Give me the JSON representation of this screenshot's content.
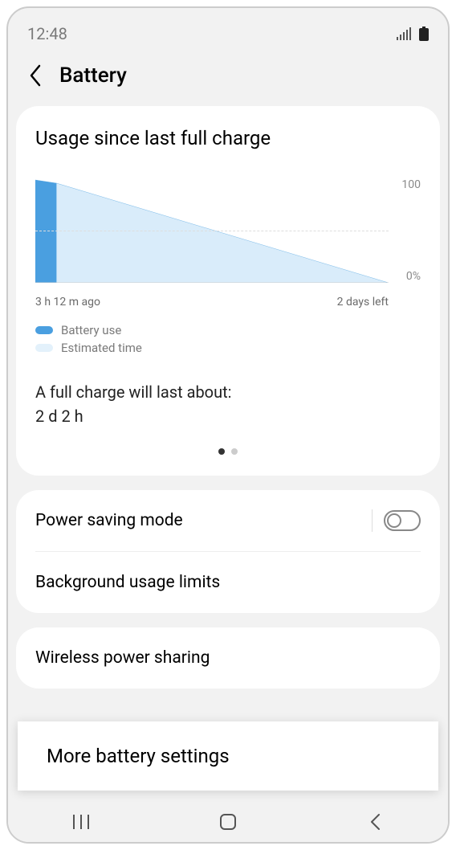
{
  "status": {
    "time": "12:48"
  },
  "page_title": "Battery",
  "usage_card": {
    "title": "Usage since last full charge",
    "chart_x_start": "3 h 12 m ago",
    "chart_x_end": "2 days left",
    "chart_y_top": "100",
    "chart_y_bottom": "0%",
    "legend_use": "Battery use",
    "legend_est": "Estimated time",
    "full_charge_label": "A full charge will last about:",
    "full_charge_value": "2 d 2 h"
  },
  "chart_data": {
    "type": "area",
    "title": "Usage since last full charge",
    "xlabel": "",
    "ylabel": "",
    "ylim": [
      0,
      100
    ],
    "x_range_labels": [
      "3 h 12 m ago",
      "2 days left"
    ],
    "series": [
      {
        "name": "Battery use",
        "x": [
          0,
          6
        ],
        "y": [
          100,
          96
        ],
        "color": "#4A9FE0"
      },
      {
        "name": "Estimated time",
        "x": [
          6,
          100
        ],
        "y": [
          96,
          0
        ],
        "color": "#CCE6F7"
      }
    ]
  },
  "colors": {
    "battery_use": "#4A9FE0",
    "estimated": "#D9ECFA"
  },
  "settings": {
    "power_saving": "Power saving mode",
    "bg_limits": "Background usage limits",
    "wireless_share": "Wireless power sharing"
  },
  "floating": {
    "label": "More battery settings"
  }
}
